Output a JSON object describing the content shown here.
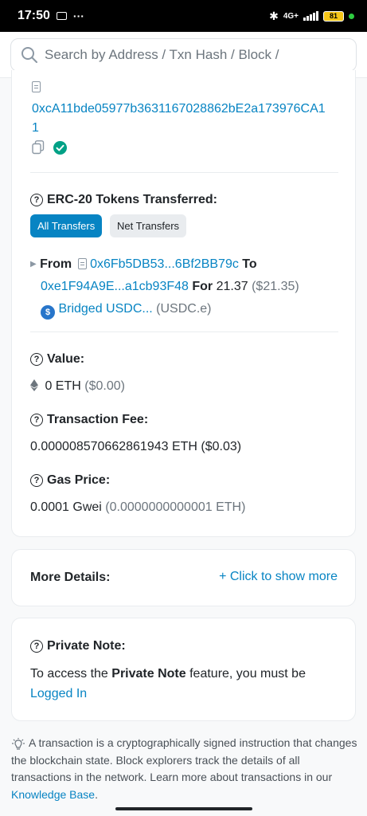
{
  "status_bar": {
    "time": "17:50",
    "more": "···",
    "network": "4G+",
    "battery": "81"
  },
  "search": {
    "placeholder": "Search by Address / Txn Hash / Block /"
  },
  "contract": {
    "address_line1": "0xcA11bde05977b3631167028862bE2a173976CA1",
    "address_line2": "1"
  },
  "erc20": {
    "heading": "ERC-20 Tokens Transferred:",
    "tab_all": "All Transfers",
    "tab_net": "Net Transfers",
    "from_label": "From",
    "from_address": "0x6Fb5DB53...6Bf2BB79c",
    "to_label": "To",
    "to_address": "0xe1F94A9E...a1cb93F48",
    "for_label": "For",
    "amount": "21.37",
    "amount_usd": "($21.35)",
    "token_name": "Bridged USDC...",
    "token_symbol": "(USDC.e)"
  },
  "value": {
    "heading": "Value:",
    "amount": "0 ETH",
    "usd": "($0.00)"
  },
  "fee": {
    "heading": "Transaction Fee:",
    "amount": "0.000008570662861943 ETH ($0.03)"
  },
  "gas": {
    "heading": "Gas Price:",
    "amount": "0.0001 Gwei",
    "eth": "(0.0000000000001 ETH)"
  },
  "more_details": {
    "label": "More Details:",
    "action": "+ Click to show more"
  },
  "private_note": {
    "heading": "Private Note:",
    "text_before": "To access the ",
    "text_bold": "Private Note",
    "text_after": " feature, you must be",
    "login": "Logged In"
  },
  "footer": {
    "text": "A transaction is a cryptographically signed instruction that changes the blockchain state. Block explorers track the details of all transactions in the network. Learn more about transactions in our ",
    "link": "Knowledge Base",
    "end": "."
  },
  "colors": {
    "accent": "#0784c3",
    "success": "#00a186",
    "muted": "#6c757d"
  }
}
